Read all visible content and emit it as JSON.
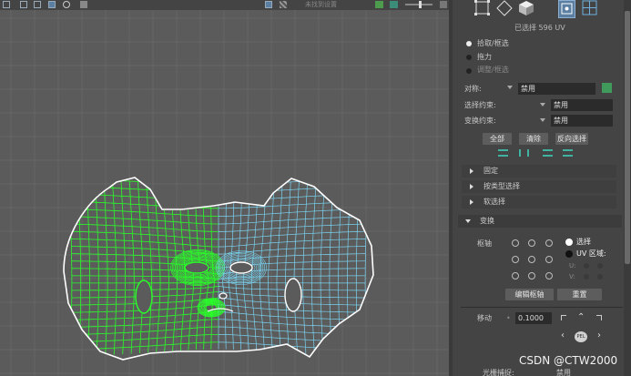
{
  "viewport": {
    "status_text": "未找到设置"
  },
  "panel": {
    "selection_count": "已选择 596 UV",
    "modes": [
      "拾取/框选",
      "拖力",
      "调整/框选"
    ],
    "symmetry": {
      "label": "对称:",
      "value": "禁用"
    },
    "selection_constraint": {
      "label": "选择约束:",
      "value": "禁用"
    },
    "transform_constraint": {
      "label": "变换约束:",
      "value": "禁用"
    },
    "buttons": {
      "all": "全部",
      "clear": "清除",
      "invert": "反向选择"
    },
    "sections": {
      "pin": "固定",
      "select_by_type": "按类型选择",
      "soft_select": "软选择",
      "transform": "变换"
    },
    "transform": {
      "pivot_label": "枢轴",
      "select_label": "选择",
      "uv_region_label": "UV 区域:",
      "u_label": "U:",
      "v_label": "V:",
      "edit_pivot": "编辑枢轴",
      "reset": "重置",
      "move_label": "移动",
      "move_value": "0.1000",
      "center_label": "PEL",
      "partial_label": "光栅捕捉:",
      "partial_value": "禁用"
    }
  },
  "watermark": "CSDN @CTW2000",
  "colors": {
    "grid": "#6a6a6a",
    "selected_uv": "#29ff29",
    "unselected_uv": "#7ad3f0",
    "border": "#ffffff",
    "viewport_bg": "#5b5b5b",
    "panel_bg": "#444444",
    "accent": "#5a7fa3"
  }
}
